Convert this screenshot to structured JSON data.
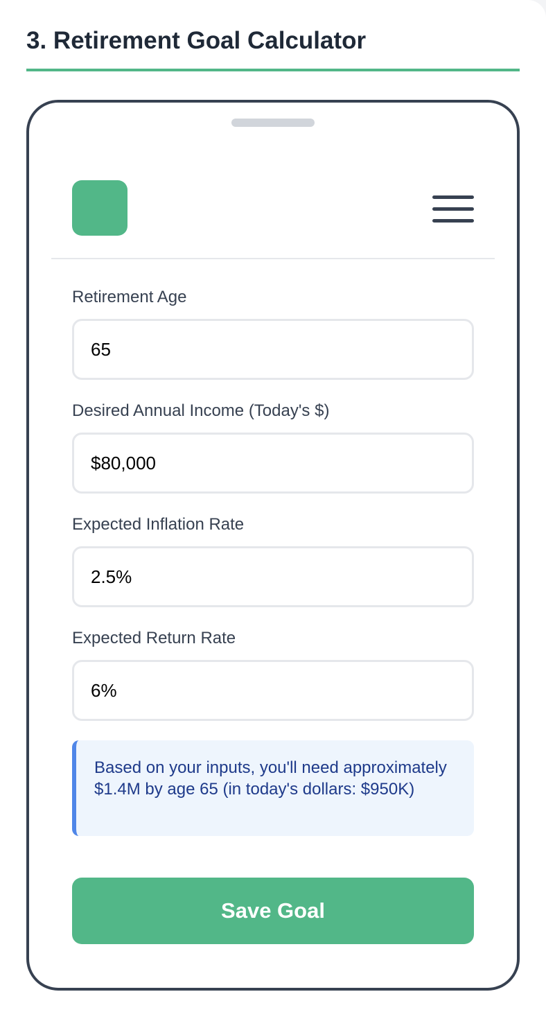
{
  "section": {
    "title": "3. Retirement Goal Calculator"
  },
  "app_header": {
    "logo_icon": "app-logo-square",
    "menu_icon": "hamburger-menu-icon"
  },
  "form": {
    "fields": [
      {
        "label": "Retirement Age",
        "value": "65"
      },
      {
        "label": "Desired Annual Income (Today's $)",
        "value": "$80,000"
      },
      {
        "label": "Expected Inflation Rate",
        "value": "2.5%"
      },
      {
        "label": "Expected Return Rate",
        "value": "6%"
      }
    ]
  },
  "info": {
    "text": "Based on your inputs, you'll need approximately $1.4M by age 65 (in today's dollars: $950K)"
  },
  "actions": {
    "save_label": "Save Goal"
  },
  "colors": {
    "accent": "#52b788",
    "phone_border": "#374151",
    "info_background": "#eef5fd",
    "info_border": "#4f86e8",
    "info_text": "#1e3a8a"
  }
}
